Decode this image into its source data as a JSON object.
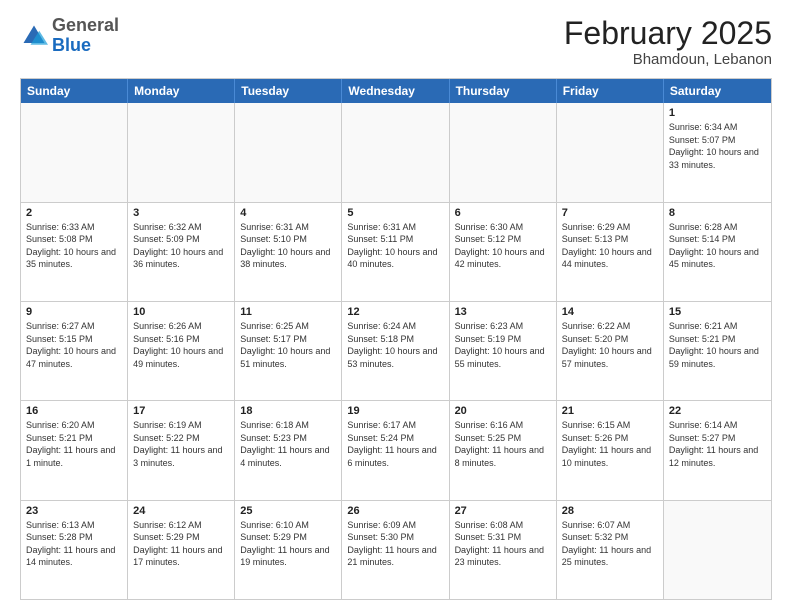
{
  "header": {
    "logo": {
      "general": "General",
      "blue": "Blue"
    },
    "title": "February 2025",
    "location": "Bhamdoun, Lebanon"
  },
  "weekdays": [
    "Sunday",
    "Monday",
    "Tuesday",
    "Wednesday",
    "Thursday",
    "Friday",
    "Saturday"
  ],
  "rows": [
    [
      {
        "day": "",
        "empty": true
      },
      {
        "day": "",
        "empty": true
      },
      {
        "day": "",
        "empty": true
      },
      {
        "day": "",
        "empty": true
      },
      {
        "day": "",
        "empty": true
      },
      {
        "day": "",
        "empty": true
      },
      {
        "day": "1",
        "sunrise": "Sunrise: 6:34 AM",
        "sunset": "Sunset: 5:07 PM",
        "daylight": "Daylight: 10 hours and 33 minutes."
      }
    ],
    [
      {
        "day": "2",
        "sunrise": "Sunrise: 6:33 AM",
        "sunset": "Sunset: 5:08 PM",
        "daylight": "Daylight: 10 hours and 35 minutes."
      },
      {
        "day": "3",
        "sunrise": "Sunrise: 6:32 AM",
        "sunset": "Sunset: 5:09 PM",
        "daylight": "Daylight: 10 hours and 36 minutes."
      },
      {
        "day": "4",
        "sunrise": "Sunrise: 6:31 AM",
        "sunset": "Sunset: 5:10 PM",
        "daylight": "Daylight: 10 hours and 38 minutes."
      },
      {
        "day": "5",
        "sunrise": "Sunrise: 6:31 AM",
        "sunset": "Sunset: 5:11 PM",
        "daylight": "Daylight: 10 hours and 40 minutes."
      },
      {
        "day": "6",
        "sunrise": "Sunrise: 6:30 AM",
        "sunset": "Sunset: 5:12 PM",
        "daylight": "Daylight: 10 hours and 42 minutes."
      },
      {
        "day": "7",
        "sunrise": "Sunrise: 6:29 AM",
        "sunset": "Sunset: 5:13 PM",
        "daylight": "Daylight: 10 hours and 44 minutes."
      },
      {
        "day": "8",
        "sunrise": "Sunrise: 6:28 AM",
        "sunset": "Sunset: 5:14 PM",
        "daylight": "Daylight: 10 hours and 45 minutes."
      }
    ],
    [
      {
        "day": "9",
        "sunrise": "Sunrise: 6:27 AM",
        "sunset": "Sunset: 5:15 PM",
        "daylight": "Daylight: 10 hours and 47 minutes."
      },
      {
        "day": "10",
        "sunrise": "Sunrise: 6:26 AM",
        "sunset": "Sunset: 5:16 PM",
        "daylight": "Daylight: 10 hours and 49 minutes."
      },
      {
        "day": "11",
        "sunrise": "Sunrise: 6:25 AM",
        "sunset": "Sunset: 5:17 PM",
        "daylight": "Daylight: 10 hours and 51 minutes."
      },
      {
        "day": "12",
        "sunrise": "Sunrise: 6:24 AM",
        "sunset": "Sunset: 5:18 PM",
        "daylight": "Daylight: 10 hours and 53 minutes."
      },
      {
        "day": "13",
        "sunrise": "Sunrise: 6:23 AM",
        "sunset": "Sunset: 5:19 PM",
        "daylight": "Daylight: 10 hours and 55 minutes."
      },
      {
        "day": "14",
        "sunrise": "Sunrise: 6:22 AM",
        "sunset": "Sunset: 5:20 PM",
        "daylight": "Daylight: 10 hours and 57 minutes."
      },
      {
        "day": "15",
        "sunrise": "Sunrise: 6:21 AM",
        "sunset": "Sunset: 5:21 PM",
        "daylight": "Daylight: 10 hours and 59 minutes."
      }
    ],
    [
      {
        "day": "16",
        "sunrise": "Sunrise: 6:20 AM",
        "sunset": "Sunset: 5:21 PM",
        "daylight": "Daylight: 11 hours and 1 minute."
      },
      {
        "day": "17",
        "sunrise": "Sunrise: 6:19 AM",
        "sunset": "Sunset: 5:22 PM",
        "daylight": "Daylight: 11 hours and 3 minutes."
      },
      {
        "day": "18",
        "sunrise": "Sunrise: 6:18 AM",
        "sunset": "Sunset: 5:23 PM",
        "daylight": "Daylight: 11 hours and 4 minutes."
      },
      {
        "day": "19",
        "sunrise": "Sunrise: 6:17 AM",
        "sunset": "Sunset: 5:24 PM",
        "daylight": "Daylight: 11 hours and 6 minutes."
      },
      {
        "day": "20",
        "sunrise": "Sunrise: 6:16 AM",
        "sunset": "Sunset: 5:25 PM",
        "daylight": "Daylight: 11 hours and 8 minutes."
      },
      {
        "day": "21",
        "sunrise": "Sunrise: 6:15 AM",
        "sunset": "Sunset: 5:26 PM",
        "daylight": "Daylight: 11 hours and 10 minutes."
      },
      {
        "day": "22",
        "sunrise": "Sunrise: 6:14 AM",
        "sunset": "Sunset: 5:27 PM",
        "daylight": "Daylight: 11 hours and 12 minutes."
      }
    ],
    [
      {
        "day": "23",
        "sunrise": "Sunrise: 6:13 AM",
        "sunset": "Sunset: 5:28 PM",
        "daylight": "Daylight: 11 hours and 14 minutes."
      },
      {
        "day": "24",
        "sunrise": "Sunrise: 6:12 AM",
        "sunset": "Sunset: 5:29 PM",
        "daylight": "Daylight: 11 hours and 17 minutes."
      },
      {
        "day": "25",
        "sunrise": "Sunrise: 6:10 AM",
        "sunset": "Sunset: 5:29 PM",
        "daylight": "Daylight: 11 hours and 19 minutes."
      },
      {
        "day": "26",
        "sunrise": "Sunrise: 6:09 AM",
        "sunset": "Sunset: 5:30 PM",
        "daylight": "Daylight: 11 hours and 21 minutes."
      },
      {
        "day": "27",
        "sunrise": "Sunrise: 6:08 AM",
        "sunset": "Sunset: 5:31 PM",
        "daylight": "Daylight: 11 hours and 23 minutes."
      },
      {
        "day": "28",
        "sunrise": "Sunrise: 6:07 AM",
        "sunset": "Sunset: 5:32 PM",
        "daylight": "Daylight: 11 hours and 25 minutes."
      },
      {
        "day": "",
        "empty": true
      }
    ]
  ]
}
